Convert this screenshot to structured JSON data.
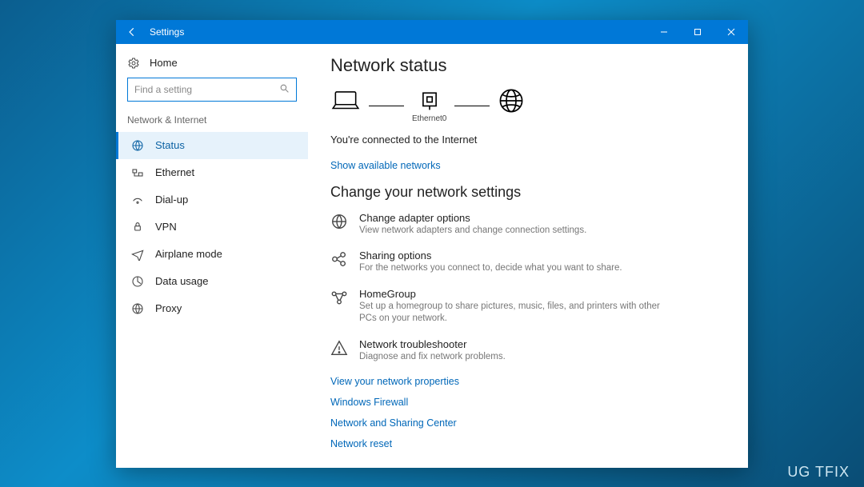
{
  "window": {
    "title": "Settings"
  },
  "sidebar": {
    "home": "Home",
    "search_placeholder": "Find a setting",
    "category": "Network & Internet",
    "items": [
      {
        "icon": "status-icon",
        "label": "Status",
        "selected": true
      },
      {
        "icon": "ethernet-icon",
        "label": "Ethernet"
      },
      {
        "icon": "dialup-icon",
        "label": "Dial-up"
      },
      {
        "icon": "vpn-icon",
        "label": "VPN"
      },
      {
        "icon": "airplane-icon",
        "label": "Airplane mode"
      },
      {
        "icon": "datausage-icon",
        "label": "Data usage"
      },
      {
        "icon": "proxy-icon",
        "label": "Proxy"
      }
    ]
  },
  "main": {
    "heading": "Network status",
    "diagram": {
      "adapter_label": "Ethernet0"
    },
    "status_text": "You're connected to the Internet",
    "show_networks": "Show available networks",
    "change_heading": "Change your network settings",
    "options": [
      {
        "title": "Change adapter options",
        "desc": "View network adapters and change connection settings."
      },
      {
        "title": "Sharing options",
        "desc": "For the networks you connect to, decide what you want to share."
      },
      {
        "title": "HomeGroup",
        "desc": "Set up a homegroup to share pictures, music, files, and printers with other PCs on your network."
      },
      {
        "title": "Network troubleshooter",
        "desc": "Diagnose and fix network problems."
      }
    ],
    "links": [
      "View your network properties",
      "Windows Firewall",
      "Network and Sharing Center",
      "Network reset"
    ]
  },
  "watermark": "UG  TFIX"
}
